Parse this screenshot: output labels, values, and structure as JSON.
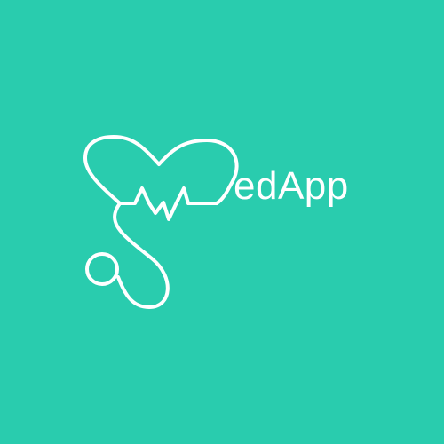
{
  "logo": {
    "text": "edApp",
    "mark_icon": "stethoscope-heart-icon",
    "colors": {
      "background": "#29CCAE",
      "foreground": "#FFFFFF"
    }
  }
}
